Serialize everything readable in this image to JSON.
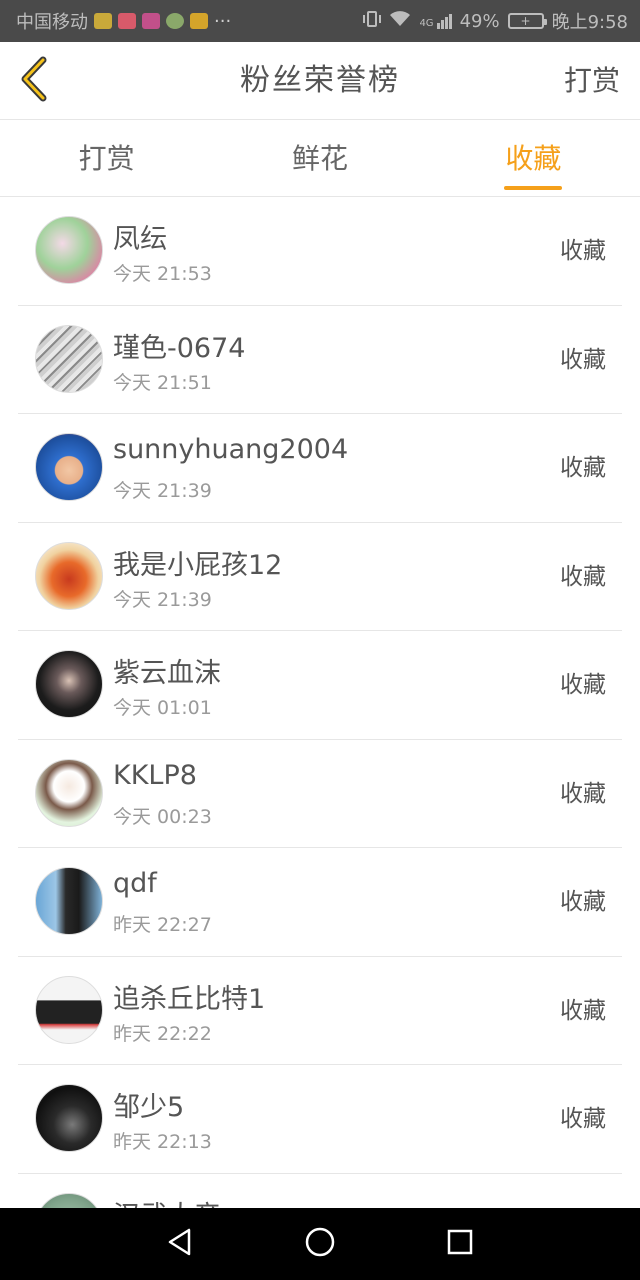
{
  "status_bar": {
    "carrier": "中国移动",
    "signal_label": "4G",
    "battery": "49%",
    "time": "晚上9:58"
  },
  "header": {
    "title": "粉丝荣誉榜",
    "action_label": "打赏"
  },
  "tabs": [
    {
      "label": "打赏",
      "active": false
    },
    {
      "label": "鲜花",
      "active": false
    },
    {
      "label": "收藏",
      "active": true
    }
  ],
  "accent_color": "#f5a01a",
  "list": [
    {
      "name": "凤纭",
      "time": "今天 21:53",
      "kind": "收藏"
    },
    {
      "name": "瑾色-0674",
      "time": "今天 21:51",
      "kind": "收藏"
    },
    {
      "name": "sunnyhuang2004",
      "time": "今天 21:39",
      "kind": "收藏"
    },
    {
      "name": "我是小屁孩12",
      "time": "今天 21:39",
      "kind": "收藏"
    },
    {
      "name": "紫云血沫",
      "time": "今天 01:01",
      "kind": "收藏"
    },
    {
      "name": "KKLP8",
      "time": "今天 00:23",
      "kind": "收藏"
    },
    {
      "name": "qdf",
      "time": "昨天 22:27",
      "kind": "收藏"
    },
    {
      "name": "追杀丘比特1",
      "time": "昨天 22:22",
      "kind": "收藏"
    },
    {
      "name": "邹少5",
      "time": "昨天 22:13",
      "kind": "收藏"
    },
    {
      "name": "汉武大帝",
      "time": "",
      "kind": ""
    }
  ]
}
